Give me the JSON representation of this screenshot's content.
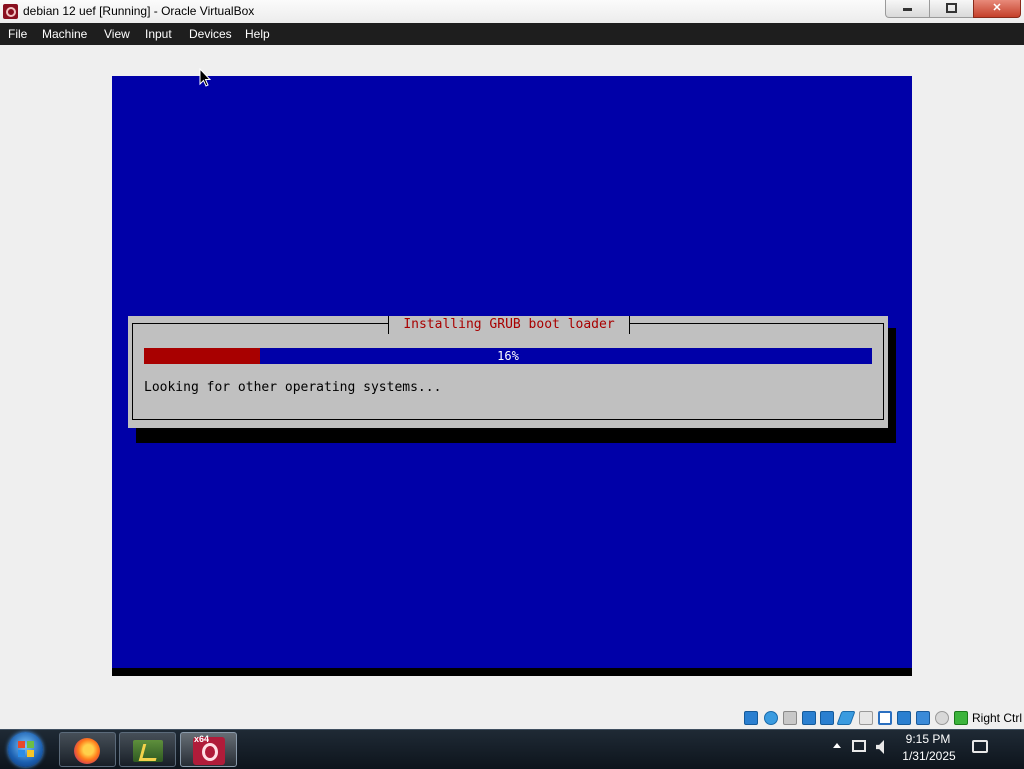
{
  "window": {
    "title": "debian 12 uef [Running] - Oracle VirtualBox",
    "controls": [
      "minimize",
      "restore",
      "close"
    ]
  },
  "menubar": {
    "items": [
      "File",
      "Machine",
      "View",
      "Input",
      "Devices",
      "Help"
    ]
  },
  "installer": {
    "dialog_title": "Installing GRUB boot loader",
    "progress_percent": 16,
    "progress_label": "16%",
    "status": "Looking for other operating systems...",
    "colors": {
      "screen": "#0000a8",
      "dialog": "#c0c0c0",
      "progress_fill": "#a80000",
      "title_text": "#a80000"
    }
  },
  "vbox_status": {
    "icons": [
      "hard-disk-icon",
      "optical-drive-icon",
      "floppy-icon",
      "audio-icon",
      "network-icon",
      "usb-icon",
      "shared-folders-icon",
      "display-icon",
      "video-capture-icon",
      "virtualization-icon",
      "mouse-integration-icon",
      "keyboard-icon"
    ],
    "host_key": "Right Ctrl"
  },
  "taskbar": {
    "apps": [
      "firefox-icon",
      "file-manager-icon",
      "virtualbox-icon"
    ],
    "virtualbox_badge": "x64",
    "time": "9:15 PM",
    "date": "1/31/2025"
  }
}
